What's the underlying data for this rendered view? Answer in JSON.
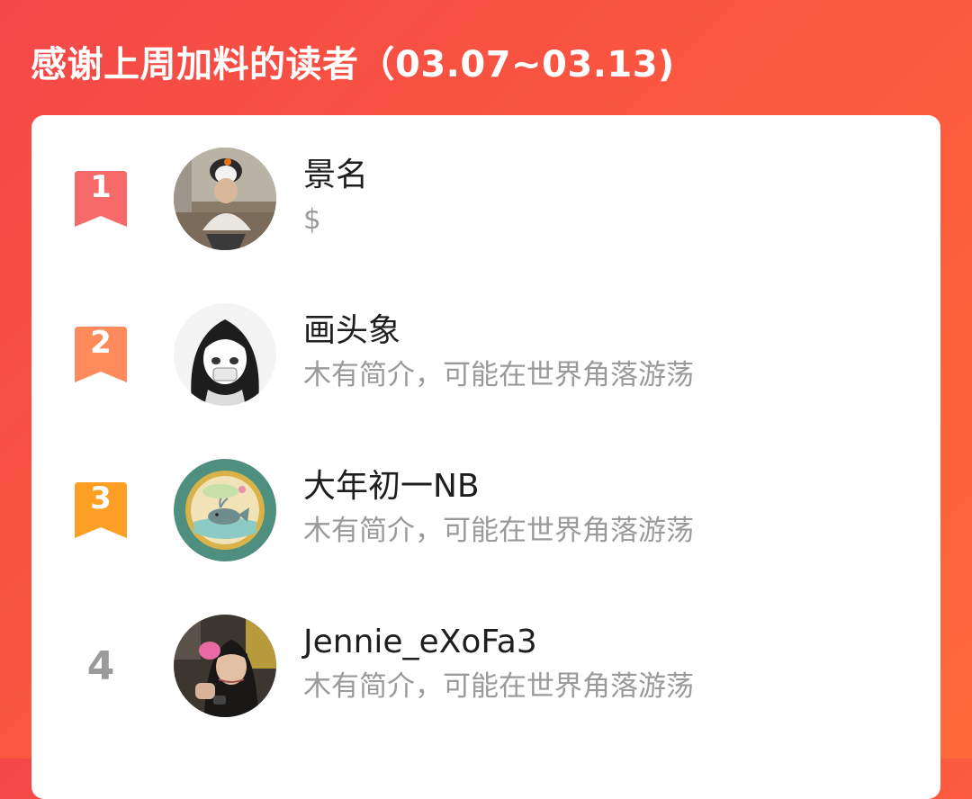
{
  "header": {
    "title": "感谢上周加料的读者（03.07~03.13)"
  },
  "colors": {
    "background_start": "#f44848",
    "background_end": "#ff6a3a",
    "rank1": "#f76a6a",
    "rank2": "#ff8a5c",
    "rank3": "#fd9f24"
  },
  "readers": [
    {
      "rank": "1",
      "name": "景名",
      "desc": "$",
      "avatar": "photo-avatar-penguin-hat"
    },
    {
      "rank": "2",
      "name": "画头象",
      "desc": "木有简介，可能在世界角落游荡",
      "avatar": "illustrated-girl-avatar"
    },
    {
      "rank": "3",
      "name": "大年初一NB",
      "desc": "木有简介，可能在世界角落游荡",
      "avatar": "whale-badge-avatar"
    },
    {
      "rank": "4",
      "name": "Jennie_eXoFa3",
      "desc": "木有简介，可能在世界角落游荡",
      "avatar": "photo-avatar-child"
    }
  ]
}
